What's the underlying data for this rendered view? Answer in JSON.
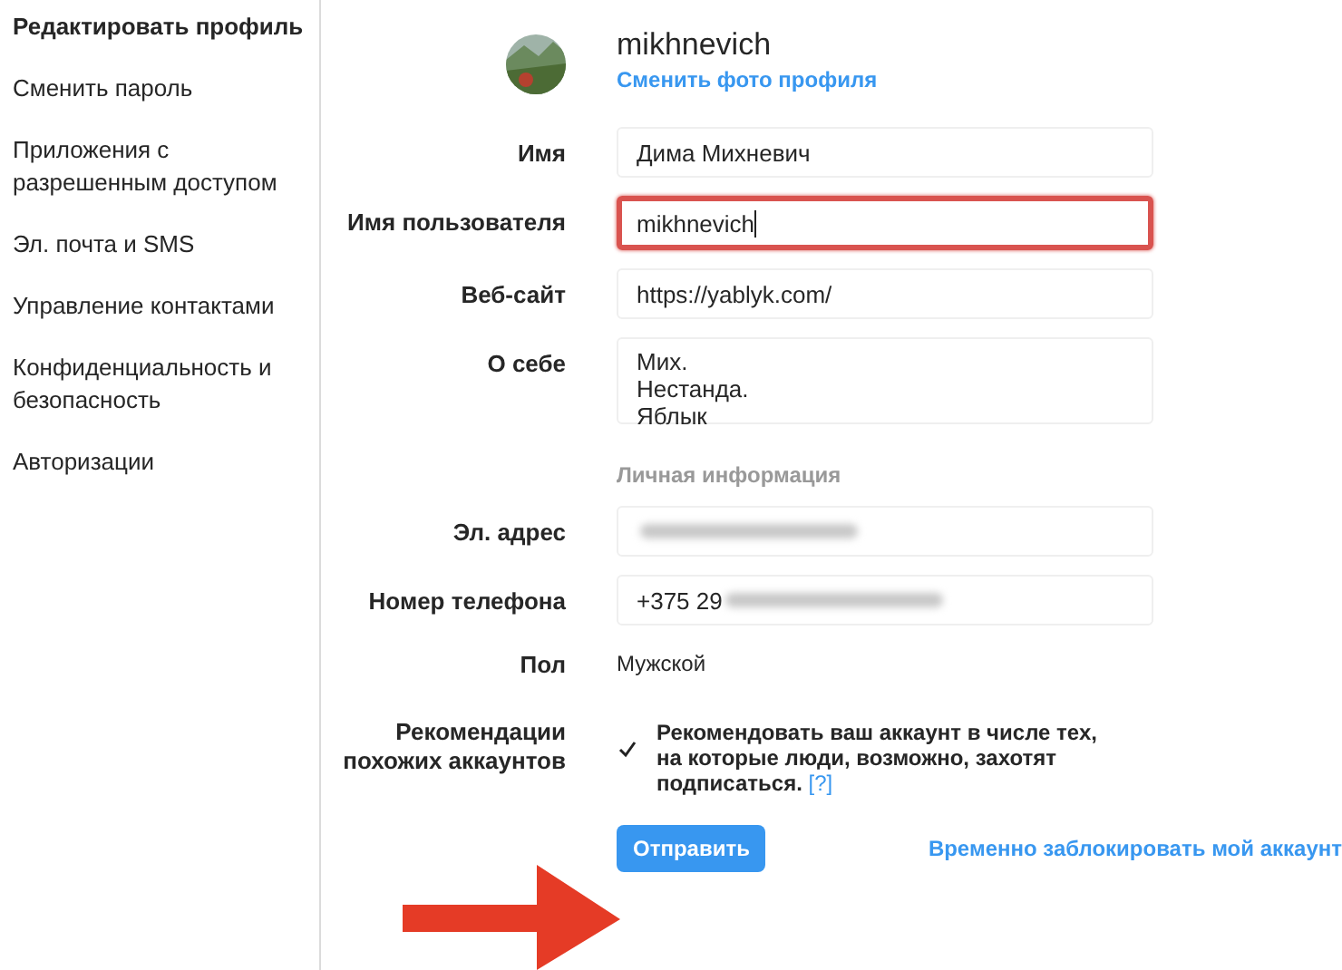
{
  "sidebar": {
    "items": [
      {
        "label": "Редактировать профиль",
        "selected": true
      },
      {
        "label": "Сменить пароль",
        "selected": false
      },
      {
        "label": "Приложения с разрешенным доступом",
        "selected": false
      },
      {
        "label": "Эл. почта и SMS",
        "selected": false
      },
      {
        "label": "Управление контактами",
        "selected": false
      },
      {
        "label": "Конфиденциальность и безопасность",
        "selected": false
      },
      {
        "label": "Авторизации",
        "selected": false
      }
    ]
  },
  "profile": {
    "username": "mikhnevich",
    "change_photo_link": "Сменить фото профиля"
  },
  "fields": [
    {
      "kind": "input",
      "label": "Имя",
      "value": "Дима Михневич",
      "highlighted": false
    },
    {
      "kind": "input",
      "label": "Имя пользователя",
      "value": "mikhnevich",
      "highlighted": true
    },
    {
      "kind": "input",
      "label": "Веб-сайт",
      "value": "https://yablyk.com/",
      "highlighted": false
    },
    {
      "kind": "textarea",
      "label": "О себе",
      "value": "Мих.\nНестанда.\nЯблык"
    },
    {
      "kind": "section",
      "text": "Личная информация"
    },
    {
      "kind": "input",
      "label": "Эл. адрес",
      "blurred": true,
      "highlighted": false
    },
    {
      "kind": "input",
      "label": "Номер телефона",
      "value": "+375 29",
      "blurred": true,
      "highlighted": false
    },
    {
      "kind": "text",
      "label": "Пол",
      "value": "Мужской"
    },
    {
      "kind": "checkbox",
      "label": "Рекомендации похожих аккаунтов",
      "text": "Рекомендовать ваш аккаунт в числе тех, на которые люди, возможно, захотят подписаться.",
      "help": "[?]",
      "checked": true
    }
  ],
  "submit_button": "Отправить",
  "disable_link": "Временно заблокировать мой аккаунт"
}
